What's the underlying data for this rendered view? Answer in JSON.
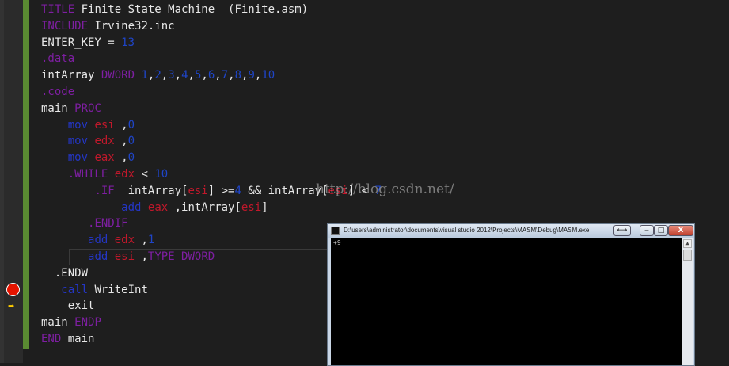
{
  "editor": {
    "lines": [
      [
        {
          "t": "TITLE",
          "c": "kw"
        },
        {
          "t": " Finite State Machine  (Finite.asm)",
          "c": ""
        }
      ],
      [
        {
          "t": "INCLUDE",
          "c": "kw"
        },
        {
          "t": " Irvine32.inc",
          "c": ""
        }
      ],
      [
        {
          "t": "ENTER_KEY = ",
          "c": ""
        },
        {
          "t": "13",
          "c": "num"
        }
      ],
      [
        {
          "t": ".data",
          "c": "kw"
        }
      ],
      [
        {
          "t": "intArray ",
          "c": ""
        },
        {
          "t": "DWORD",
          "c": "kw"
        },
        {
          "t": " ",
          "c": ""
        },
        {
          "t": "1",
          "c": "num"
        },
        {
          "t": ",",
          "c": ""
        },
        {
          "t": "2",
          "c": "num"
        },
        {
          "t": ",",
          "c": ""
        },
        {
          "t": "3",
          "c": "num"
        },
        {
          "t": ",",
          "c": ""
        },
        {
          "t": "4",
          "c": "num"
        },
        {
          "t": ",",
          "c": ""
        },
        {
          "t": "5",
          "c": "num"
        },
        {
          "t": ",",
          "c": ""
        },
        {
          "t": "6",
          "c": "num"
        },
        {
          "t": ",",
          "c": ""
        },
        {
          "t": "7",
          "c": "num"
        },
        {
          "t": ",",
          "c": ""
        },
        {
          "t": "8",
          "c": "num"
        },
        {
          "t": ",",
          "c": ""
        },
        {
          "t": "9",
          "c": "num"
        },
        {
          "t": ",",
          "c": ""
        },
        {
          "t": "10",
          "c": "num"
        }
      ],
      [
        {
          "t": ".code",
          "c": "kw"
        }
      ],
      [
        {
          "t": "main ",
          "c": ""
        },
        {
          "t": "PROC",
          "c": "kw"
        }
      ],
      [
        {
          "t": "    ",
          "c": ""
        },
        {
          "t": "mov",
          "c": "instr"
        },
        {
          "t": " ",
          "c": ""
        },
        {
          "t": "esi",
          "c": "reg"
        },
        {
          "t": " ,",
          "c": ""
        },
        {
          "t": "0",
          "c": "num"
        }
      ],
      [
        {
          "t": "    ",
          "c": ""
        },
        {
          "t": "mov",
          "c": "instr"
        },
        {
          "t": " ",
          "c": ""
        },
        {
          "t": "edx",
          "c": "reg"
        },
        {
          "t": " ,",
          "c": ""
        },
        {
          "t": "0",
          "c": "num"
        }
      ],
      [
        {
          "t": "    ",
          "c": ""
        },
        {
          "t": "mov",
          "c": "instr"
        },
        {
          "t": " ",
          "c": ""
        },
        {
          "t": "eax",
          "c": "reg"
        },
        {
          "t": " ,",
          "c": ""
        },
        {
          "t": "0",
          "c": "num"
        }
      ],
      [
        {
          "t": "    ",
          "c": ""
        },
        {
          "t": ".WHILE",
          "c": "kw"
        },
        {
          "t": " ",
          "c": ""
        },
        {
          "t": "edx",
          "c": "reg"
        },
        {
          "t": " < ",
          "c": ""
        },
        {
          "t": "10",
          "c": "num"
        }
      ],
      [
        {
          "t": "        ",
          "c": ""
        },
        {
          "t": ".IF",
          "c": "kw"
        },
        {
          "t": "  intArray[",
          "c": ""
        },
        {
          "t": "esi",
          "c": "reg"
        },
        {
          "t": "] >=",
          "c": ""
        },
        {
          "t": "4",
          "c": "num"
        },
        {
          "t": " && intArray[",
          "c": ""
        },
        {
          "t": "esi",
          "c": "reg"
        },
        {
          "t": "] < ",
          "c": ""
        },
        {
          "t": "7",
          "c": "num"
        }
      ],
      [
        {
          "t": "            ",
          "c": ""
        },
        {
          "t": "add",
          "c": "instr"
        },
        {
          "t": " ",
          "c": ""
        },
        {
          "t": "eax",
          "c": "reg"
        },
        {
          "t": " ,intArray[",
          "c": ""
        },
        {
          "t": "esi",
          "c": "reg"
        },
        {
          "t": "]",
          "c": ""
        }
      ],
      [
        {
          "t": "       ",
          "c": ""
        },
        {
          "t": ".ENDIF",
          "c": "kw"
        }
      ],
      [
        {
          "t": "       ",
          "c": ""
        },
        {
          "t": "add",
          "c": "instr"
        },
        {
          "t": " ",
          "c": ""
        },
        {
          "t": "edx",
          "c": "reg"
        },
        {
          "t": " ,",
          "c": ""
        },
        {
          "t": "1",
          "c": "num"
        }
      ],
      [
        {
          "t": "       ",
          "c": ""
        },
        {
          "t": "add",
          "c": "instr"
        },
        {
          "t": " ",
          "c": ""
        },
        {
          "t": "esi",
          "c": "reg"
        },
        {
          "t": " ,",
          "c": ""
        },
        {
          "t": "TYPE DWORD",
          "c": "kw"
        }
      ],
      [
        {
          "t": "  .ENDW",
          "c": ""
        }
      ],
      [
        {
          "t": "   ",
          "c": ""
        },
        {
          "t": "call",
          "c": "instr"
        },
        {
          "t": " WriteInt",
          "c": ""
        }
      ],
      [
        {
          "t": "    exit",
          "c": ""
        }
      ],
      [
        {
          "t": "main ",
          "c": ""
        },
        {
          "t": "ENDP",
          "c": "kw"
        }
      ],
      [
        {
          "t": "END",
          "c": "kw"
        },
        {
          "t": " main",
          "c": ""
        }
      ]
    ],
    "watermark": "http://blog.csdn.net/"
  },
  "console": {
    "title": "D:\\users\\administrator\\documents\\visual studio 2012\\Projects\\MASM\\Debug\\MASM.exe",
    "output": "+9",
    "buttons": {
      "swap": "⟷",
      "minimize": "‒",
      "maximize": "□",
      "close": "X"
    }
  },
  "colors": {
    "keyword": "#7e1fa2",
    "number": "#1f45c8",
    "register": "#c2182b",
    "instruction": "#2436c5",
    "breakpoint": "#e51400"
  },
  "icons": {
    "breakpoint": "breakpoint-icon",
    "current_statement": "current-statement-arrow-icon"
  }
}
